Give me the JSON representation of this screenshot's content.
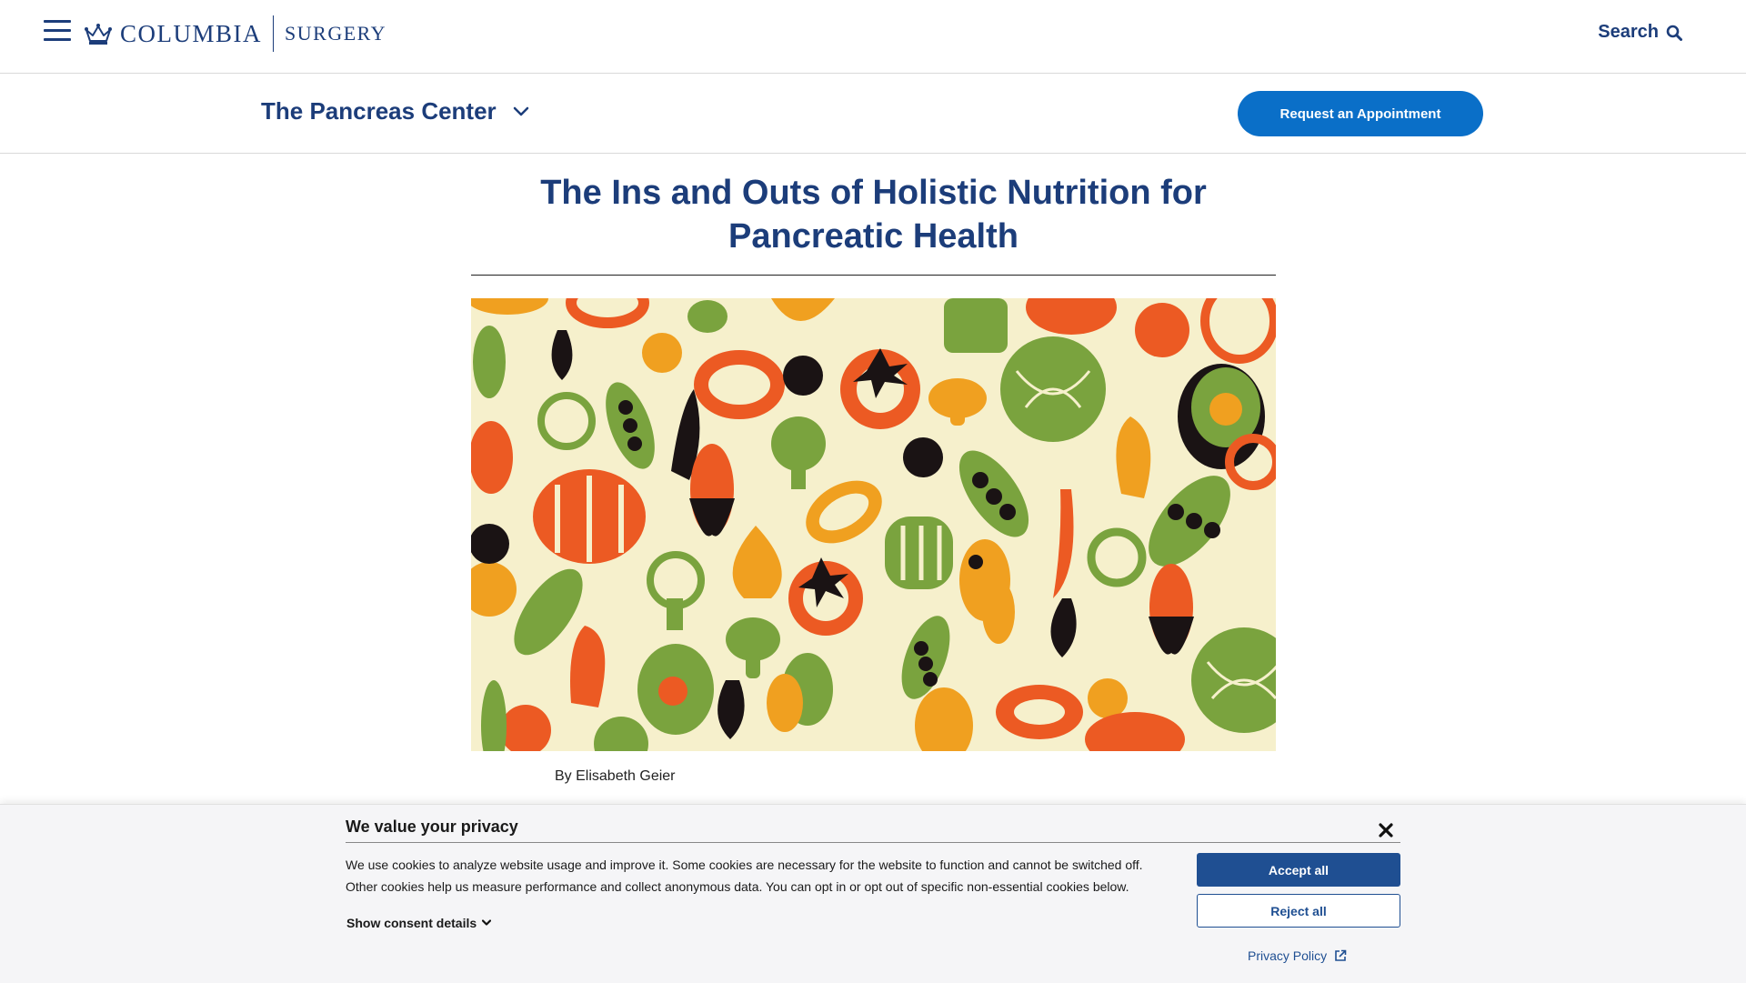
{
  "header": {
    "logo_main": "COLUMBIA",
    "logo_sub": "SURGERY",
    "search_label": "Search"
  },
  "subnav": {
    "section_title": "The Pancreas Center",
    "appointment_button": "Request an Appointment"
  },
  "article": {
    "title": "The Ins and Outs of Holistic Nutrition for Pancreatic Health",
    "byline": "By Elisabeth Geier",
    "hero_image": "vegetable-pattern-illustration"
  },
  "cookie_banner": {
    "title": "We value your privacy",
    "body": "We use cookies to analyze website usage and improve it. Some cookies are necessary for the website to function and cannot be switched off. Other cookies help us measure performance and collect anonymous data. You can opt in or opt out of specific non-essential cookies below.",
    "show_details": "Show consent details",
    "accept_label": "Accept all",
    "reject_label": "Reject all",
    "privacy_label": "Privacy Policy"
  },
  "colors": {
    "brand_navy": "#1c3d7a",
    "cta_blue": "#0a6fc8",
    "consent_blue": "#1f4f92",
    "hero_background": "#f6f0cc"
  },
  "icons": [
    "hamburger-menu-icon",
    "columbia-crown-icon",
    "search-icon",
    "chevron-down-icon",
    "close-icon",
    "external-link-icon"
  ]
}
